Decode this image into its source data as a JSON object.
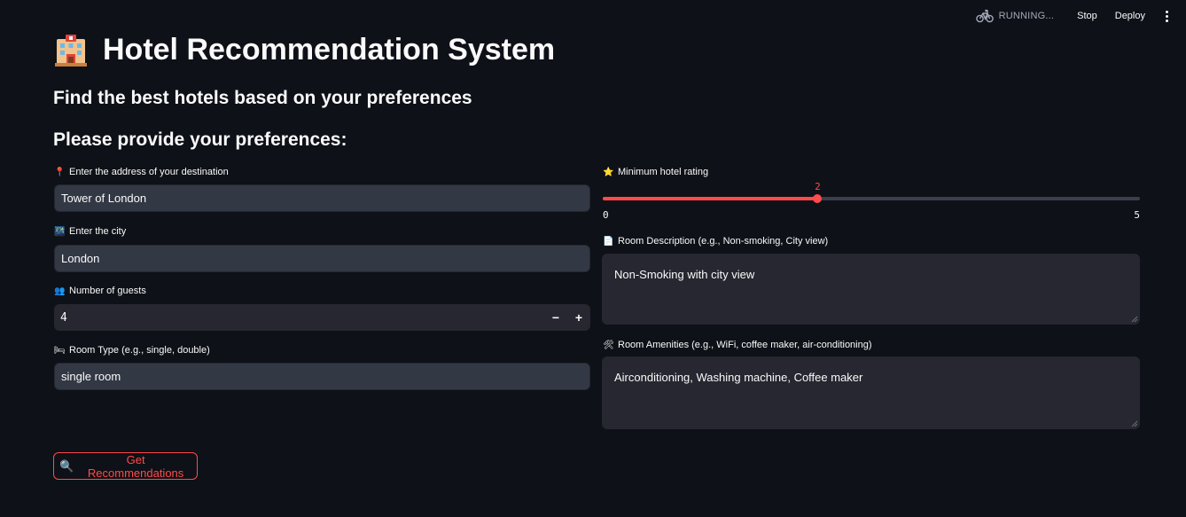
{
  "topbar": {
    "status": "RUNNING...",
    "stop": "Stop",
    "deploy": "Deploy"
  },
  "header": {
    "title": "Hotel Recommendation System",
    "subtitle": "Find the best hotels based on your preferences",
    "section": "Please provide your preferences:"
  },
  "form": {
    "address": {
      "label": "Enter the address of your destination",
      "value": "Tower of London",
      "icon": "📍"
    },
    "city": {
      "label": "Enter the city",
      "value": "London",
      "icon": "🌃"
    },
    "guests": {
      "label": "Number of guests",
      "value": "4",
      "icon": "👥",
      "minus": "−",
      "plus": "+"
    },
    "room_type": {
      "label": "Room Type (e.g., single, double)",
      "value": "single room",
      "icon": "🛏"
    },
    "rating": {
      "label": "Minimum hotel rating",
      "value": 2,
      "min": 0,
      "max": 5,
      "value_text": "2",
      "min_text": "0",
      "max_text": "5",
      "icon": "⭐"
    },
    "description": {
      "label": "Room Description (e.g., Non-smoking, City view)",
      "value": "Non-Smoking with city view",
      "icon": "📄"
    },
    "amenities": {
      "label": "Room Amenities (e.g., WiFi, coffee maker, air-conditioning)",
      "value": "Airconditioning, Washing machine, Coffee maker",
      "icon": "🛠"
    }
  },
  "submit": {
    "label": "Get Recommendations",
    "icon": "🔍"
  },
  "colors": {
    "accent": "#ff4b4b",
    "background": "#0e1117",
    "input": "#262730"
  }
}
